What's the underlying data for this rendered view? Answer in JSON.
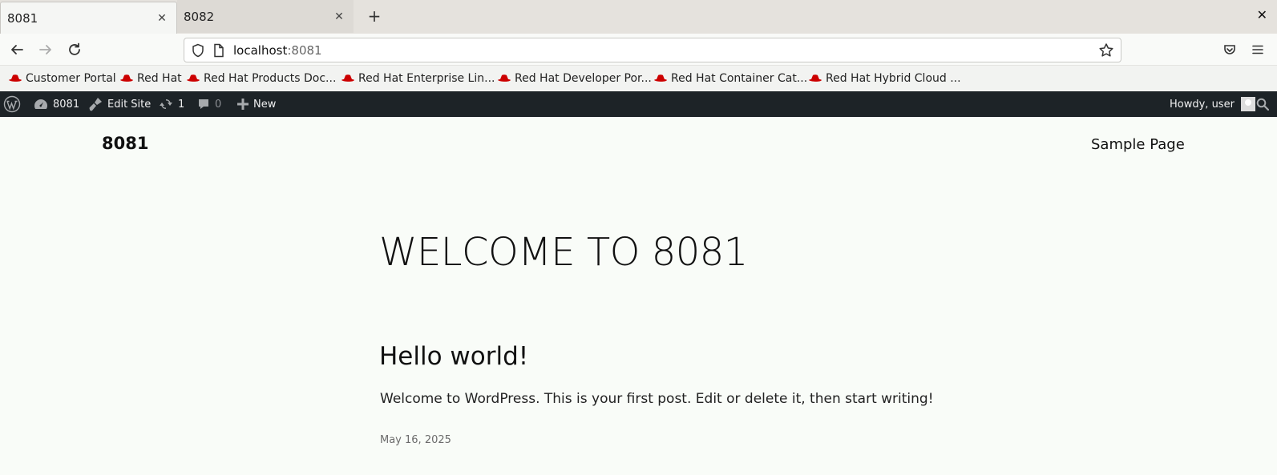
{
  "browser": {
    "tabs": [
      {
        "label": "8081",
        "active": true
      },
      {
        "label": "8082",
        "active": false
      }
    ],
    "url": {
      "host": "localhost",
      "port": ":8081"
    },
    "bookmarks": [
      "Customer Portal",
      "Red Hat",
      "Red Hat Products Doc...",
      "Red Hat Enterprise Lin...",
      "Red Hat Developer Por...",
      "Red Hat Container Cat...",
      "Red Hat Hybrid Cloud ..."
    ]
  },
  "adminbar": {
    "site_name": "8081",
    "edit_site": "Edit Site",
    "updates_count": "1",
    "comments_count": "0",
    "new_label": "New",
    "howdy": "Howdy, user"
  },
  "site": {
    "title": "8081",
    "nav_item": "Sample Page",
    "heading": "WELCOME TO 8081"
  },
  "post": {
    "title": "Hello world!",
    "excerpt": "Welcome to WordPress. This is your first post. Edit or delete it, then start writing!",
    "date": "May 16, 2025"
  },
  "colors": {
    "adminbar_bg": "#1d2327",
    "page_bg": "#f9fcf8",
    "redhat_red": "#cc0000"
  }
}
